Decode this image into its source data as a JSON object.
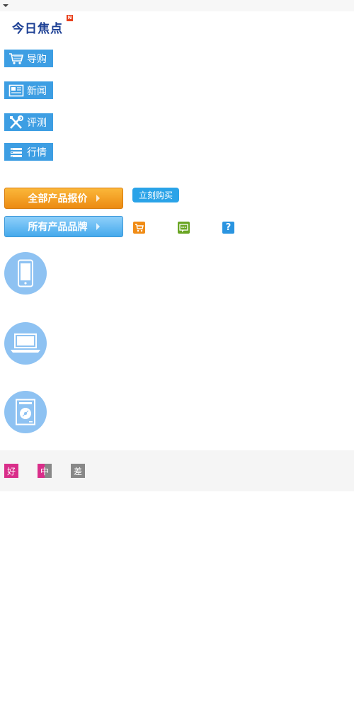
{
  "focus": {
    "title": "今日焦点",
    "badge": "N"
  },
  "categories": [
    {
      "label": "导购",
      "icon": "shopping-cart-icon"
    },
    {
      "label": "新闻",
      "icon": "newspaper-icon"
    },
    {
      "label": "评测",
      "icon": "tools-icon"
    },
    {
      "label": "行情",
      "icon": "list-icon"
    }
  ],
  "buttons": {
    "all_prices": "全部产品报价",
    "all_brands": "所有产品品牌",
    "buy_now": "立刻购买"
  },
  "mini_icons": [
    "cart-icon",
    "comment-icon",
    "question-icon"
  ],
  "devices": [
    "mobile-phone-icon",
    "laptop-icon",
    "disc-drive-icon"
  ],
  "ratings": {
    "good": "好",
    "medium": "中",
    "bad": "差"
  },
  "colors": {
    "brand_blue": "#3d9ee3",
    "title_blue": "#1c3f94",
    "orange": "#ec8b12",
    "good": "#d92e8a",
    "bad": "#888888",
    "green_icon": "#6aa524",
    "device_circle": "#8ec2f2"
  }
}
